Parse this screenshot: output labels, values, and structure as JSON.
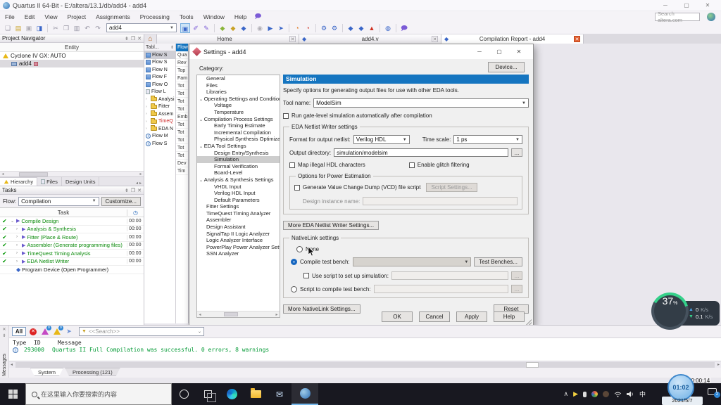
{
  "window": {
    "title": "Quartus II 64-Bit - E:/altera/13.1/db/add4 - add4"
  },
  "icons": {
    "minimize": "─",
    "maximize": "▢",
    "close": "✕",
    "pin": "⇟",
    "float": "❐",
    "chevron_down": "⌄",
    "left": "◂",
    "right": "▸",
    "up": "∧",
    "home": "⌂",
    "diamond": "◆",
    "clock": "◷",
    "check": "✔",
    "play": "▶",
    "info": "i",
    "flag": "➤",
    "funnel": "▼",
    "mail": "✉",
    "dots": "..."
  },
  "menu": {
    "items": [
      "File",
      "Edit",
      "View",
      "Project",
      "Assignments",
      "Processing",
      "Tools",
      "Window",
      "Help"
    ]
  },
  "toolbar": {
    "project_combo": "add4",
    "search_placeholder": "Search altera.com"
  },
  "tabs": {
    "home": "Home",
    "source": "add4.v",
    "report": "Compilation Report - add4"
  },
  "project_navigator": {
    "title": "Project Navigator",
    "column_header": "Entity",
    "device_node": "Cyclone IV GX: AUTO",
    "entity_node": "add4",
    "tabs": [
      "Hierarchy",
      "Files",
      "Design Units"
    ]
  },
  "tasks": {
    "title": "Tasks",
    "flow_label": "Flow:",
    "flow_value": "Compilation",
    "customize_label": "Customize...",
    "column_header": "Task",
    "rows": [
      {
        "label": "Compile Design",
        "time": "00:00"
      },
      {
        "label": "Analysis & Synthesis",
        "time": "00:00"
      },
      {
        "label": "Fitter (Place & Route)",
        "time": "00:00"
      },
      {
        "label": "Assembler (Generate programming files)",
        "time": "00:00"
      },
      {
        "label": "TimeQuest Timing Analysis",
        "time": "00:00"
      },
      {
        "label": "EDA Netlist Writer",
        "time": "00:00"
      },
      {
        "label": "Program Device (Open Programmer)",
        "time": ""
      }
    ]
  },
  "report": {
    "toc_header": "Tabl...",
    "toc_items": [
      "Flow S",
      "Flow S",
      "Flow N",
      "Flow F",
      "Flow O",
      "Flow L",
      "Analysi",
      "Fitter",
      "Assem",
      "TimeQ",
      "EDA N",
      "Flow M",
      "Flow S"
    ],
    "fragments": [
      "Flow",
      "Qua",
      "Rev",
      "Top",
      "Fam",
      "Tot",
      "Tot",
      "Tot",
      "Tot",
      "Emb",
      "Tot",
      "Tot",
      "Tot",
      "Tot",
      "Tot",
      "Dev",
      "Tim"
    ]
  },
  "dialog": {
    "title": "Settings - add4",
    "category_label": "Category:",
    "device_button": "Device...",
    "categories": [
      "General",
      "Files",
      "Libraries",
      "Operating Settings and Conditions",
      "Voltage",
      "Temperature",
      "Compilation Process Settings",
      "Early Timing Estimate",
      "Incremental Compilation",
      "Physical Synthesis Optimization",
      "EDA Tool Settings",
      "Design Entry/Synthesis",
      "Simulation",
      "Formal Verification",
      "Board-Level",
      "Analysis & Synthesis Settings",
      "VHDL Input",
      "Verilog HDL Input",
      "Default Parameters",
      "Fitter Settings",
      "TimeQuest Timing Analyzer",
      "Assembler",
      "Design Assistant",
      "SignalTap II Logic Analyzer",
      "Logic Analyzer Interface",
      "PowerPlay Power Analyzer Setting",
      "SSN Analyzer"
    ],
    "pane": {
      "header": "Simulation",
      "description": "Specify options for generating output files for use with other EDA tools.",
      "tool_name_label": "Tool name:",
      "tool_name_value": "ModelSim",
      "run_gate_label": "Run gate-level simulation automatically after compilation",
      "eda_group_label": "EDA Netlist Writer settings",
      "format_label": "Format for output netlist:",
      "format_value": "Verilog HDL",
      "time_scale_label": "Time scale:",
      "time_scale_value": "1 ps",
      "output_dir_label": "Output directory:",
      "output_dir_value": "simulation/modelsim",
      "browse_label": "...",
      "map_illegal_label": "Map illegal HDL characters",
      "glitch_label": "Enable glitch filtering",
      "power_group_label": "Options for Power Estimation",
      "vcd_label": "Generate Value Change Dump (VCD) file script",
      "script_settings_label": "Script Settings...",
      "design_instance_label": "Design instance name:",
      "more_eda_label": "More EDA Netlist Writer Settings...",
      "nativelink_group_label": "NativeLink settings",
      "none_label": "None",
      "compile_tb_label": "Compile test bench:",
      "test_benches_label": "Test Benches...",
      "use_script_label": "Use script to set up simulation:",
      "script_compile_label": "Script to compile test bench:",
      "more_nativelink_label": "More NativeLink Settings...",
      "reset_label": "Reset",
      "ok": "OK",
      "cancel": "Cancel",
      "apply": "Apply",
      "help": "Help"
    }
  },
  "messages": {
    "all_label": "All",
    "critical_badge": "8",
    "warning_badge": "8",
    "search_value": "<<Search>>",
    "columns": [
      "Type",
      "ID",
      "Message"
    ],
    "rows": [
      {
        "id": "293000",
        "text": "Quartus II Full Compilation was successful. 0 errors, 8 warnings"
      }
    ],
    "tabs": [
      "System",
      "Processing (121)"
    ],
    "side_label": "Messages"
  },
  "taskbar": {
    "search_placeholder": "在这里输入你要搜索的内容",
    "ime": "中"
  },
  "tray": {
    "clock": "01:02",
    "date": "2021/5/7",
    "notification_badge": "2",
    "recording_timer": "00:00:14"
  },
  "net_widget": {
    "percent": "37",
    "percent_unit": "%",
    "up_value": "0",
    "up_unit": "K/s",
    "down_value": "0.1",
    "down_unit": "K/s"
  }
}
